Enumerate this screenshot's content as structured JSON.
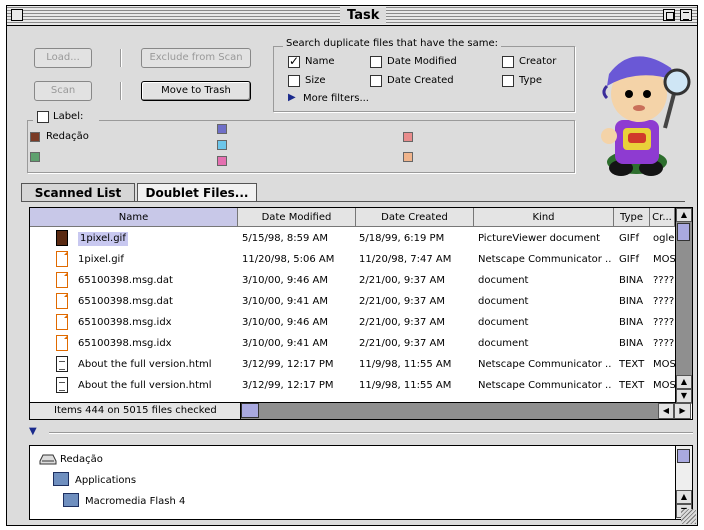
{
  "window": {
    "title": "Task"
  },
  "buttons": {
    "load": "Load...",
    "exclude": "Exclude from Scan",
    "scan": "Scan",
    "move_to_trash": "Move to Trash"
  },
  "search": {
    "heading": "Search duplicate files that have the same:",
    "options": [
      {
        "label": "Name",
        "checked": true
      },
      {
        "label": "Date Modified",
        "checked": false
      },
      {
        "label": "Creator",
        "checked": false
      },
      {
        "label": "Size",
        "checked": false
      },
      {
        "label": "Date Created",
        "checked": false
      },
      {
        "label": "Type",
        "checked": false
      }
    ],
    "more_filters": "More filters..."
  },
  "label_group": {
    "title": "Label:",
    "items": [
      {
        "name": "Redação",
        "color": "#7a3b26"
      }
    ],
    "swatches": [
      "#5ea06e",
      "#6f6fc8",
      "#6cc6ea",
      "#e46fb0",
      "#e88c8c",
      "#f0b48c"
    ]
  },
  "tabs": [
    "Scanned List",
    "Doublet Files..."
  ],
  "table": {
    "columns": [
      "Name",
      "Date Modified",
      "Date Created",
      "Kind",
      "Type",
      "Cr..."
    ],
    "rows": [
      {
        "name": "1pixel.gif",
        "modified": "5/15/98, 8:59 AM",
        "created": "5/18/99, 6:19 PM",
        "kind": "PictureViewer document",
        "type": "GIFf",
        "creator": "ogle",
        "icon": "gif",
        "selected": true
      },
      {
        "name": "1pixel.gif",
        "modified": "11/20/98, 5:06 AM",
        "created": "11/20/98, 7:47 AM",
        "kind": "Netscape Communicator ...",
        "type": "GIFf",
        "creator": "MOSS",
        "icon": "doc-orange",
        "selected": false
      },
      {
        "name": "65100398.msg.dat",
        "modified": "3/10/00, 9:46 AM",
        "created": "2/21/00, 9:37 AM",
        "kind": "document",
        "type": "BINA",
        "creator": "????",
        "icon": "doc-orange",
        "selected": false
      },
      {
        "name": "65100398.msg.dat",
        "modified": "3/10/00, 9:41 AM",
        "created": "2/21/00, 9:37 AM",
        "kind": "document",
        "type": "BINA",
        "creator": "????",
        "icon": "doc-orange",
        "selected": false
      },
      {
        "name": "65100398.msg.idx",
        "modified": "3/10/00, 9:46 AM",
        "created": "2/21/00, 9:37 AM",
        "kind": "document",
        "type": "BINA",
        "creator": "????",
        "icon": "doc-orange",
        "selected": false
      },
      {
        "name": "65100398.msg.idx",
        "modified": "3/10/00, 9:41 AM",
        "created": "2/21/00, 9:37 AM",
        "kind": "document",
        "type": "BINA",
        "creator": "????",
        "icon": "doc-orange",
        "selected": false
      },
      {
        "name": "About the full version.html",
        "modified": "3/12/99, 12:17 PM",
        "created": "11/9/98, 11:55 AM",
        "kind": "Netscape Communicator ...",
        "type": "TEXT",
        "creator": "MOSS",
        "icon": "html",
        "selected": false
      },
      {
        "name": "About the full version.html",
        "modified": "3/12/99, 12:17 PM",
        "created": "11/9/98, 11:55 AM",
        "kind": "Netscape Communicator ...",
        "type": "TEXT",
        "creator": "MOSS",
        "icon": "html",
        "selected": false
      }
    ],
    "status": "Items 444 on 5015 files checked"
  },
  "path_list": {
    "items": [
      "Redação",
      "Applications",
      "Macromedia Flash 4"
    ]
  }
}
